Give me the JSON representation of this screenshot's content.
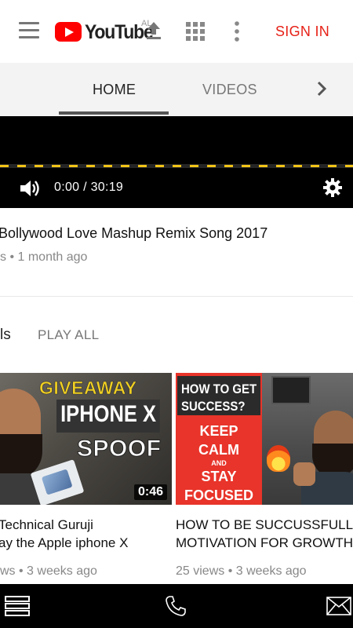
{
  "header": {
    "logo_text": "YouTube",
    "logo_badge": "AL",
    "signin_label": "SIGN IN",
    "accent_color": "#e62117"
  },
  "tabs": [
    {
      "label": "HOME",
      "selected": true
    },
    {
      "label": "VIDEOS",
      "selected": false
    }
  ],
  "player": {
    "time": "0:00 / 30:19",
    "progress_fraction": 0
  },
  "video": {
    "title": "Bollywood Love Mashup Remix Song 2017",
    "meta": "s • 1 month ago"
  },
  "section": {
    "title": "ls",
    "play_all_label": "PLAY ALL"
  },
  "items": [
    {
      "thumb_line1": "GIVEAWAY",
      "thumb_line2": "IPHONE X",
      "thumb_line3": "SPOOF",
      "duration": "0:46",
      "title_line1": "Technical Guruji",
      "title_line2": "ay the Apple iphone X",
      "meta": "ws • 3 weeks ago"
    },
    {
      "thumb_line1": "HOW TO GET",
      "thumb_line2": "SUCCESS?",
      "thumb_keep": "KEEP",
      "thumb_calm": "CALM",
      "thumb_and": "AND",
      "thumb_stay": "STAY",
      "thumb_focused": "FOCUSED",
      "title_line1": "HOW TO BE SUCCUSSFULL",
      "title_line2": "MOTIVATION FOR GROWTH",
      "meta": "25 views • 3 weeks ago"
    }
  ],
  "icons": {
    "menu": "hamburger-icon",
    "upload": "upload-icon",
    "apps": "apps-grid-icon",
    "more": "more-vert-icon",
    "chevron": "chevron-right-icon",
    "volume": "volume-icon",
    "settings": "gear-icon",
    "bottom_menu": "menu-icon",
    "phone": "phone-icon",
    "mail": "mail-icon"
  }
}
